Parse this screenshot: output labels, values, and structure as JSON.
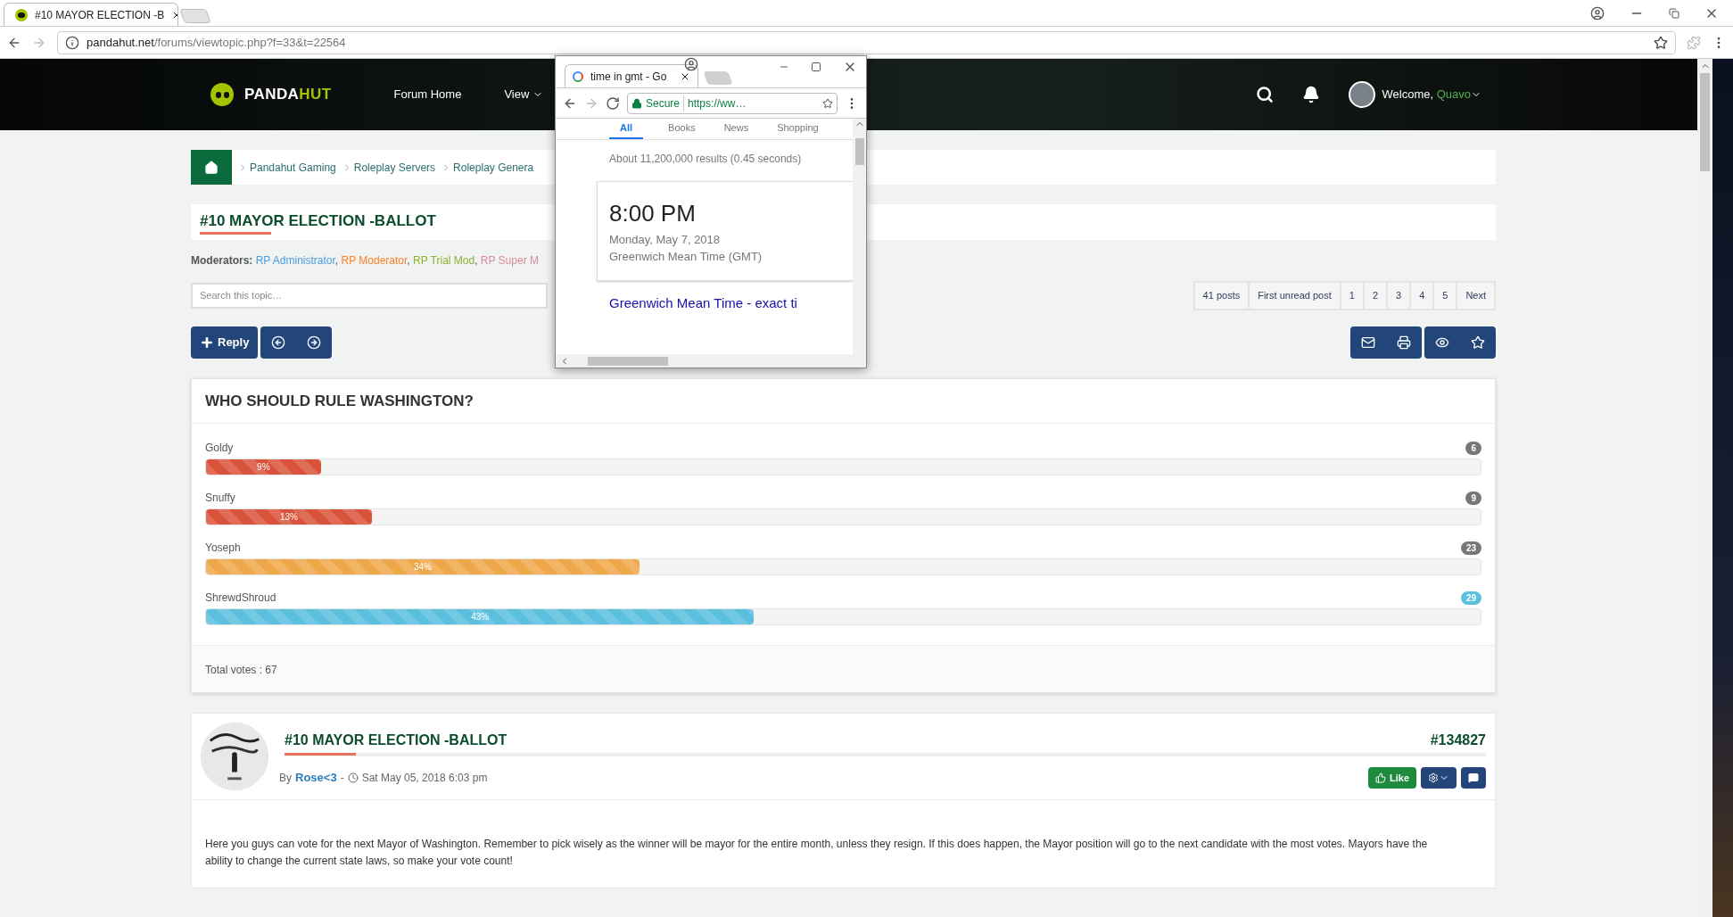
{
  "browser": {
    "tab": {
      "title": "#10 MAYOR ELECTION -B"
    },
    "address": {
      "host": "pandahut.net",
      "path": "/forums/viewtopic.php?f=33&t=22564"
    }
  },
  "navbar": {
    "logo": {
      "part_1": "PANDA",
      "part_2": "HUT"
    },
    "links": [
      {
        "label": "Forum Home",
        "dropdown": false
      },
      {
        "label": "View",
        "dropdown": true
      }
    ],
    "welcome": "Welcome,",
    "username": "Quavo"
  },
  "breadcrumb": [
    "Pandahut Gaming",
    "Roleplay Servers",
    "Roleplay Genera"
  ],
  "topic": {
    "title": "#10 MAYOR ELECTION -BALLOT"
  },
  "moderators": {
    "label": "Moderators:",
    "separator": ",",
    "groups": [
      {
        "name": "RP Administrator",
        "color": "#4a9ee0"
      },
      {
        "name": "RP Moderator",
        "color": "#ff7f24"
      },
      {
        "name": "RP Trial Mod",
        "color": "#8fb12c"
      },
      {
        "name": "RP Super M",
        "color": "#d88a9c"
      }
    ]
  },
  "search": {
    "placeholder": "Search this topic…"
  },
  "pagination": [
    "41 posts",
    "First unread post",
    "1",
    "2",
    "3",
    "4",
    "5",
    "Next"
  ],
  "actions": {
    "reply": "Reply"
  },
  "poll": {
    "title": "WHO SHOULD RULE WASHINGTON?",
    "options": [
      {
        "name": "Goldy",
        "level": 0.09,
        "percent": "9%",
        "votes": "6",
        "color": "#d9533b",
        "leading": false
      },
      {
        "name": "Snuffy",
        "level": 0.13,
        "percent": "13%",
        "votes": "9",
        "color": "#d9533b",
        "leading": false
      },
      {
        "name": "Yoseph",
        "level": 0.34,
        "percent": "34%",
        "votes": "23",
        "color": "#eea84a",
        "leading": false
      },
      {
        "name": "ShrewdShroud",
        "level": 0.43,
        "percent": "43%",
        "votes": "29",
        "color": "#5bc0de",
        "leading": true
      }
    ],
    "total": "Total votes : 67"
  },
  "post": {
    "title": "#10 MAYOR ELECTION -BALLOT",
    "id": "#134827",
    "by": "By",
    "author": "Rose<3",
    "separator": "-",
    "date": "Sat May 05, 2018 6:03 pm",
    "like": "Like",
    "body": "Here you guys can vote for the next Mayor of Washington. Remember to pick wisely as the winner will be mayor for the entire month, unless they resign. If this does happen, the Mayor position will go to the next candidate with the most votes. Mayors have the ability to change the current state laws, so make your vote count!"
  },
  "popup": {
    "tab_title": "time in gmt - Go",
    "secure": "Secure",
    "url": "https://ww…",
    "search_tabs": [
      {
        "label": "All",
        "selected": true
      },
      {
        "label": "Books",
        "selected": false
      },
      {
        "label": "News",
        "selected": false
      },
      {
        "label": "Shopping",
        "selected": false
      }
    ],
    "results": "About 11,200,000 results (0.45 seconds)",
    "time": "8:00 PM",
    "date": "Monday, May 7, 2018",
    "zone": "Greenwich Mean Time (GMT)",
    "link": "Greenwich Mean Time - exact ti"
  }
}
